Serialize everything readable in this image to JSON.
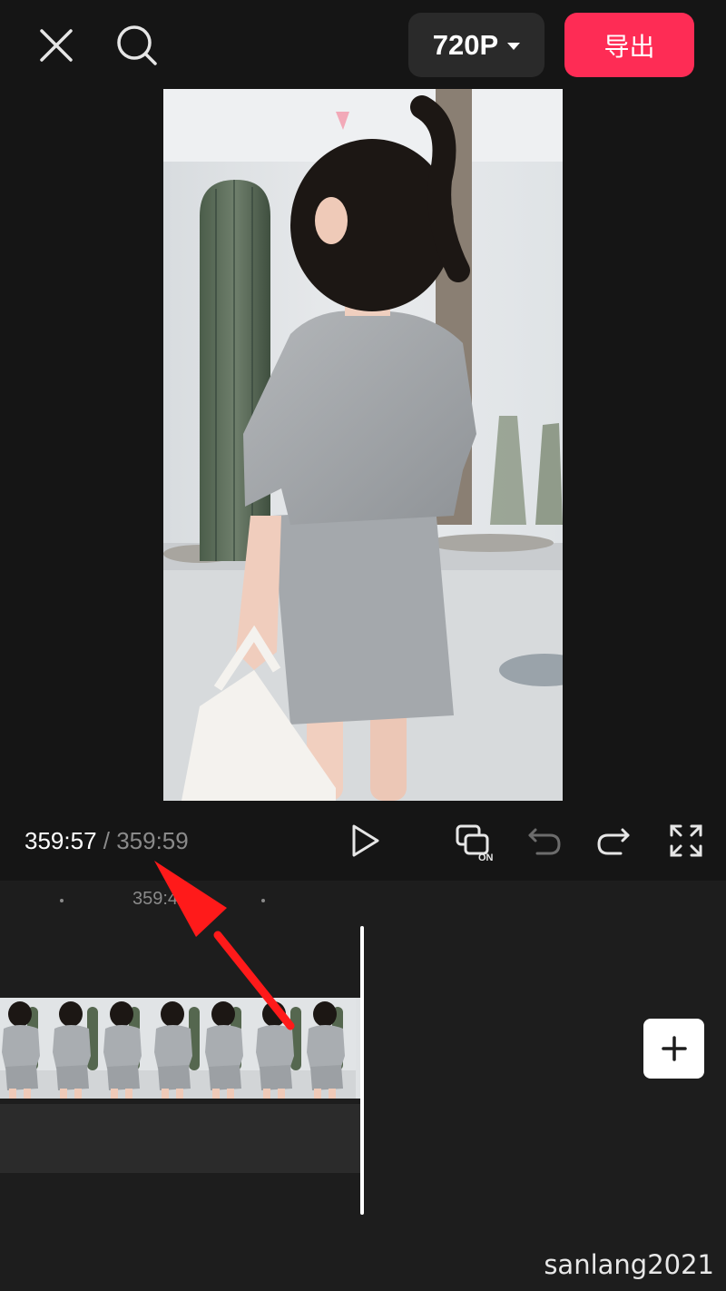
{
  "topbar": {
    "close_icon": "close-icon",
    "search_icon": "search-icon",
    "resolution_label": "720P",
    "export_label": "导出",
    "export_color": "#fe2c55"
  },
  "preview": {
    "image_description_icon": "video-frame"
  },
  "controls": {
    "current_time": "359:57",
    "separator": " / ",
    "total_time": "359:59",
    "play_icon": "play-icon",
    "keyframe_icon": "keyframe-on-icon",
    "undo_icon": "undo-icon",
    "redo_icon": "redo-icon",
    "fullscreen_icon": "fullscreen-icon"
  },
  "timeline": {
    "ruler_label": "359:4",
    "thumbnail_count": 7,
    "add_icon": "plus-icon"
  },
  "watermark": "sanlang2021",
  "annotation": {
    "arrow_color": "#ff1a1a"
  }
}
